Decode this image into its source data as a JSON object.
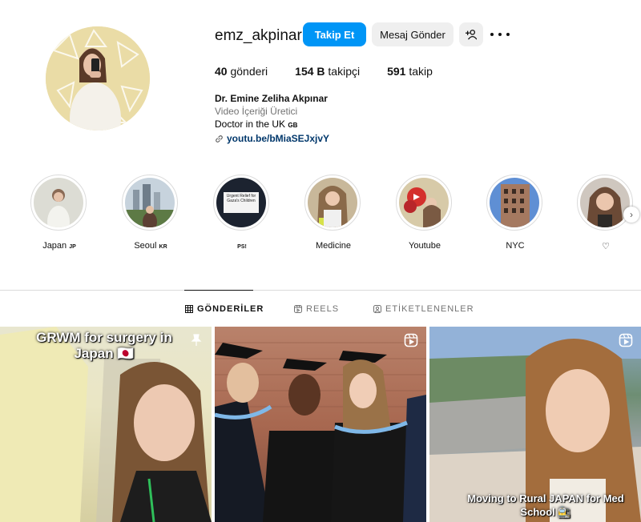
{
  "profile": {
    "username": "emz_akpinar",
    "follow_label": "Takip Et",
    "message_label": "Mesaj Gönder",
    "stats": [
      {
        "count": "40",
        "label": "gönderi"
      },
      {
        "count": "154 B",
        "label": "takipçi"
      },
      {
        "count": "591",
        "label": "takip"
      }
    ],
    "bio": {
      "name": "Dr. Emine Zeliha Akpınar",
      "category": "Video İçeriği Üretici",
      "line": "Doctor in the UK",
      "line_flag": "GB",
      "link": "youtu.be/bMiaSEJxjvY"
    }
  },
  "highlights": [
    {
      "label": "Japan",
      "flag": "JP"
    },
    {
      "label": "Seoul",
      "flag": "KR"
    },
    {
      "label": "",
      "flag": "PS!"
    },
    {
      "label": "Medicine",
      "flag": ""
    },
    {
      "label": "Youtube",
      "flag": ""
    },
    {
      "label": "NYC",
      "flag": ""
    },
    {
      "label": "♡",
      "flag": ""
    }
  ],
  "highlight_inner_text": "Urgent Relief for Gaza's Children",
  "tabs": [
    {
      "label": "GÖNDERİLER",
      "active": true
    },
    {
      "label": "REELS",
      "active": false
    },
    {
      "label": "ETİKETLENENLER",
      "active": false
    }
  ],
  "posts": [
    {
      "caption": "GRWM for surgery in Japan",
      "caption_flag": "🇯🇵",
      "badge": "pin-icon"
    },
    {
      "caption": "",
      "badge": "reel-icon"
    },
    {
      "caption": "Moving to Rural JAPAN for Med School 🚉",
      "badge": "reel-icon"
    }
  ],
  "colors": {
    "accent": "#0095f6",
    "link": "#00376b",
    "muted": "#737373",
    "border": "#dbdbdb"
  }
}
